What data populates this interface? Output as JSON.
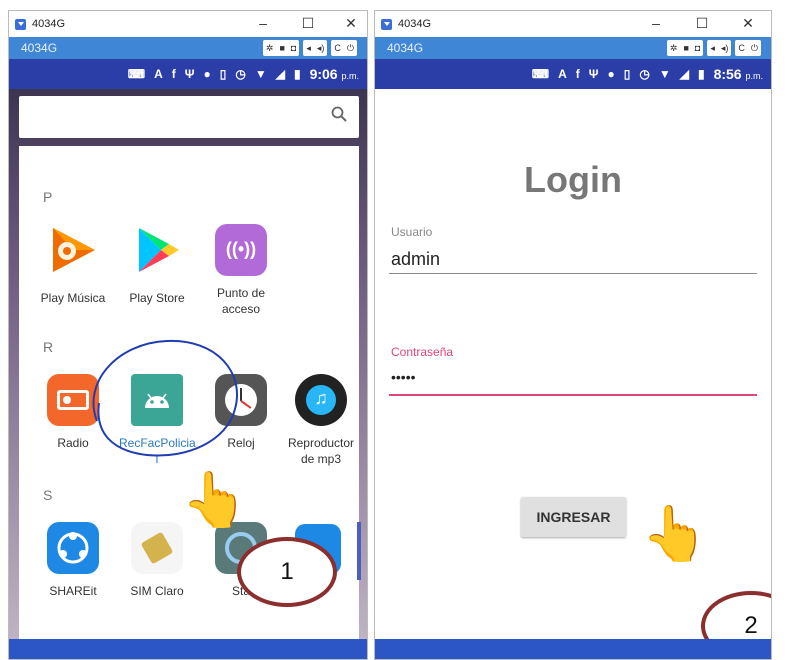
{
  "window1": {
    "title": "4034G",
    "device_label": "4034G",
    "status_time": "9:06",
    "status_ampm": "p.m.",
    "search_placeholder": "",
    "sections": [
      {
        "letter": "P",
        "apps": [
          {
            "label_l1": "Play Música",
            "label_l2": "",
            "icon": "play-music-icon"
          },
          {
            "label_l1": "Play Store",
            "label_l2": "",
            "icon": "play-store-icon"
          },
          {
            "label_l1": "Punto de",
            "label_l2": "acceso",
            "icon": "hotspot-icon"
          }
        ]
      },
      {
        "letter": "R",
        "apps": [
          {
            "label_l1": "Radio",
            "label_l2": "",
            "icon": "radio-icon"
          },
          {
            "label_l1": "RecFacPolicia",
            "label_l2": "l",
            "icon": "android-icon"
          },
          {
            "label_l1": "Reloj",
            "label_l2": "",
            "icon": "clock-icon"
          },
          {
            "label_l1": "Reproductor",
            "label_l2": "de mp3",
            "icon": "music-player-icon"
          }
        ]
      },
      {
        "letter": "S",
        "apps": [
          {
            "label_l1": "SHAREit",
            "label_l2": "",
            "icon": "shareit-icon"
          },
          {
            "label_l1": "SIM Claro",
            "label_l2": "",
            "icon": "sim-card-icon"
          },
          {
            "label_l1": "Sta",
            "label_l2": "",
            "icon": "sta-app-icon"
          }
        ]
      }
    ],
    "step_number": "1"
  },
  "window2": {
    "title": "4034G",
    "device_label": "4034G",
    "status_time": "8:56",
    "status_ampm": "p.m.",
    "login_title": "Login",
    "username_label": "Usuario",
    "username_value": "admin",
    "password_label": "Contraseña",
    "password_value": "•••••",
    "submit_label": "INGRESAR",
    "step_number": "2"
  },
  "colors": {
    "toolbar_blue": "#3f87d6",
    "statusbar_blue": "#2b3ea8",
    "accent_pink": "#e0457c",
    "badge_border": "#8b2e2e",
    "selection_circle": "#1f3cb0"
  }
}
